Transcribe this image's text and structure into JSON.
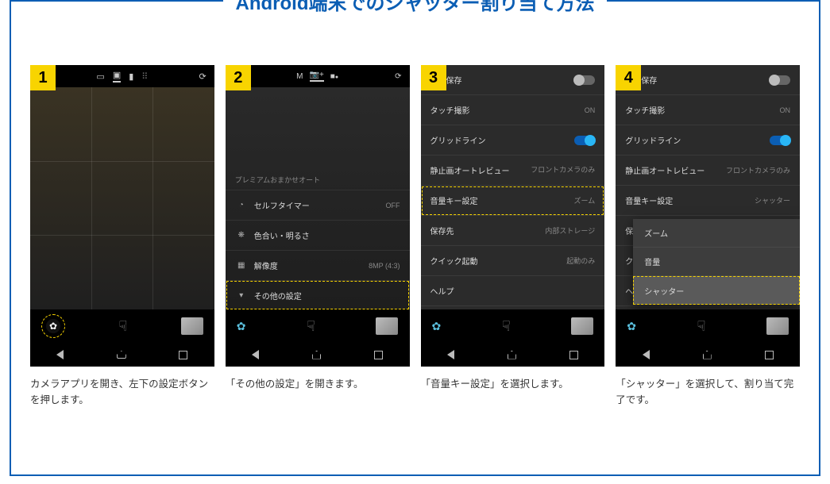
{
  "title": "Android端末でのシャッター割り当て方法",
  "steps": [
    {
      "num": "1",
      "caption": "カメラアプリを開き、左下の設定ボタンを押します。"
    },
    {
      "num": "2",
      "caption": "「その他の設定」を開きます。"
    },
    {
      "num": "3",
      "caption": "「音量キー設定」を選択します。"
    },
    {
      "num": "4",
      "caption": "「シャッター」を選択して、割り当て完了です。"
    }
  ],
  "step2": {
    "section": "プレミアムおまかせオート",
    "rows": [
      {
        "id": "self-timer",
        "icon": "◔",
        "label": "セルフタイマー",
        "value": "OFF"
      },
      {
        "id": "color-brightness",
        "icon": "❋",
        "label": "色合い・明るさ",
        "value": ""
      },
      {
        "id": "resolution",
        "icon": "▦",
        "label": "解像度",
        "value": "8MP (4:3)"
      },
      {
        "id": "other-settings",
        "icon": "▾",
        "label": "その他の設定",
        "value": ""
      }
    ],
    "topbar": {
      "m": "M",
      "cam": "📷+",
      "vid": "■"
    }
  },
  "settings": {
    "rows": [
      {
        "id": "save",
        "label": "報を保存",
        "type": "toggle",
        "state": "off"
      },
      {
        "id": "touch-shoot",
        "label": "タッチ撮影",
        "type": "text",
        "value": "ON"
      },
      {
        "id": "gridline",
        "label": "グリッドライン",
        "type": "toggle",
        "state": "on"
      },
      {
        "id": "still-review",
        "label": "静止画オートレビュー",
        "type": "text",
        "value": "フロントカメラのみ"
      },
      {
        "id": "volume-key",
        "label": "音量キー設定",
        "type": "text",
        "value": "ズーム",
        "value4": "シャッター"
      },
      {
        "id": "save-dest",
        "label": "保存先",
        "type": "text",
        "value": "内部ストレージ"
      },
      {
        "id": "quick-launch",
        "label": "クイック起動",
        "type": "text",
        "value": "起動のみ"
      },
      {
        "id": "help",
        "label": "ヘルプ",
        "type": "text",
        "value": ""
      }
    ]
  },
  "step4": {
    "popup": [
      {
        "id": "zoom",
        "label": "ズーム",
        "selected": false
      },
      {
        "id": "volume",
        "label": "音量",
        "selected": false
      },
      {
        "id": "shutter",
        "label": "シャッター",
        "selected": true
      }
    ],
    "trunc": {
      "save": "保存",
      "quick": "クイ",
      "help": "ヘル"
    }
  },
  "colors": {
    "accent": "#0b5eb4",
    "highlight": "#f8d400",
    "toggleOn": "#29b6f6"
  }
}
